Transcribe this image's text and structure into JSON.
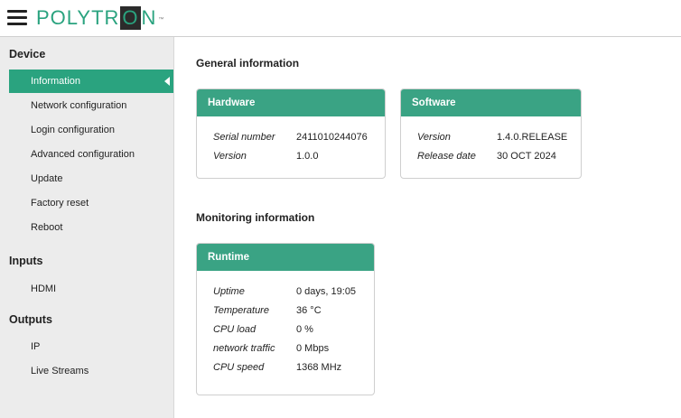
{
  "brand": {
    "logo_pre": "POLYTR",
    "logo_box": "O",
    "logo_post": "N",
    "logo_tm": "™",
    "color": "#2aa37f"
  },
  "sidebar": {
    "groups": [
      {
        "title": "Device",
        "items": [
          "Information",
          "Network configuration",
          "Login configuration",
          "Advanced configuration",
          "Update",
          "Factory reset",
          "Reboot"
        ]
      },
      {
        "title": "Inputs",
        "items": [
          "HDMI"
        ]
      },
      {
        "title": "Outputs",
        "items": [
          "IP",
          "Live Streams"
        ]
      }
    ],
    "active": "Information"
  },
  "main": {
    "general_title": "General information",
    "monitoring_title": "Monitoring information",
    "hardware": {
      "title": "Hardware",
      "rows": [
        {
          "k": "Serial number",
          "v": "2411010244076"
        },
        {
          "k": "Version",
          "v": "1.0.0"
        }
      ]
    },
    "software": {
      "title": "Software",
      "rows": [
        {
          "k": "Version",
          "v": "1.4.0.RELEASE"
        },
        {
          "k": "Release date",
          "v": "30 OCT 2024"
        }
      ]
    },
    "runtime": {
      "title": "Runtime",
      "rows": [
        {
          "k": "Uptime",
          "v": "0 days, 19:05"
        },
        {
          "k": "Temperature",
          "v": "36 °C"
        },
        {
          "k": "CPU load",
          "v": "0 %"
        },
        {
          "k": "network traffic",
          "v": "0 Mbps"
        },
        {
          "k": "CPU speed",
          "v": "1368 MHz"
        }
      ]
    }
  },
  "icons": {
    "menu": "hamburger-menu-icon",
    "active_marker": "caret-left-icon"
  }
}
